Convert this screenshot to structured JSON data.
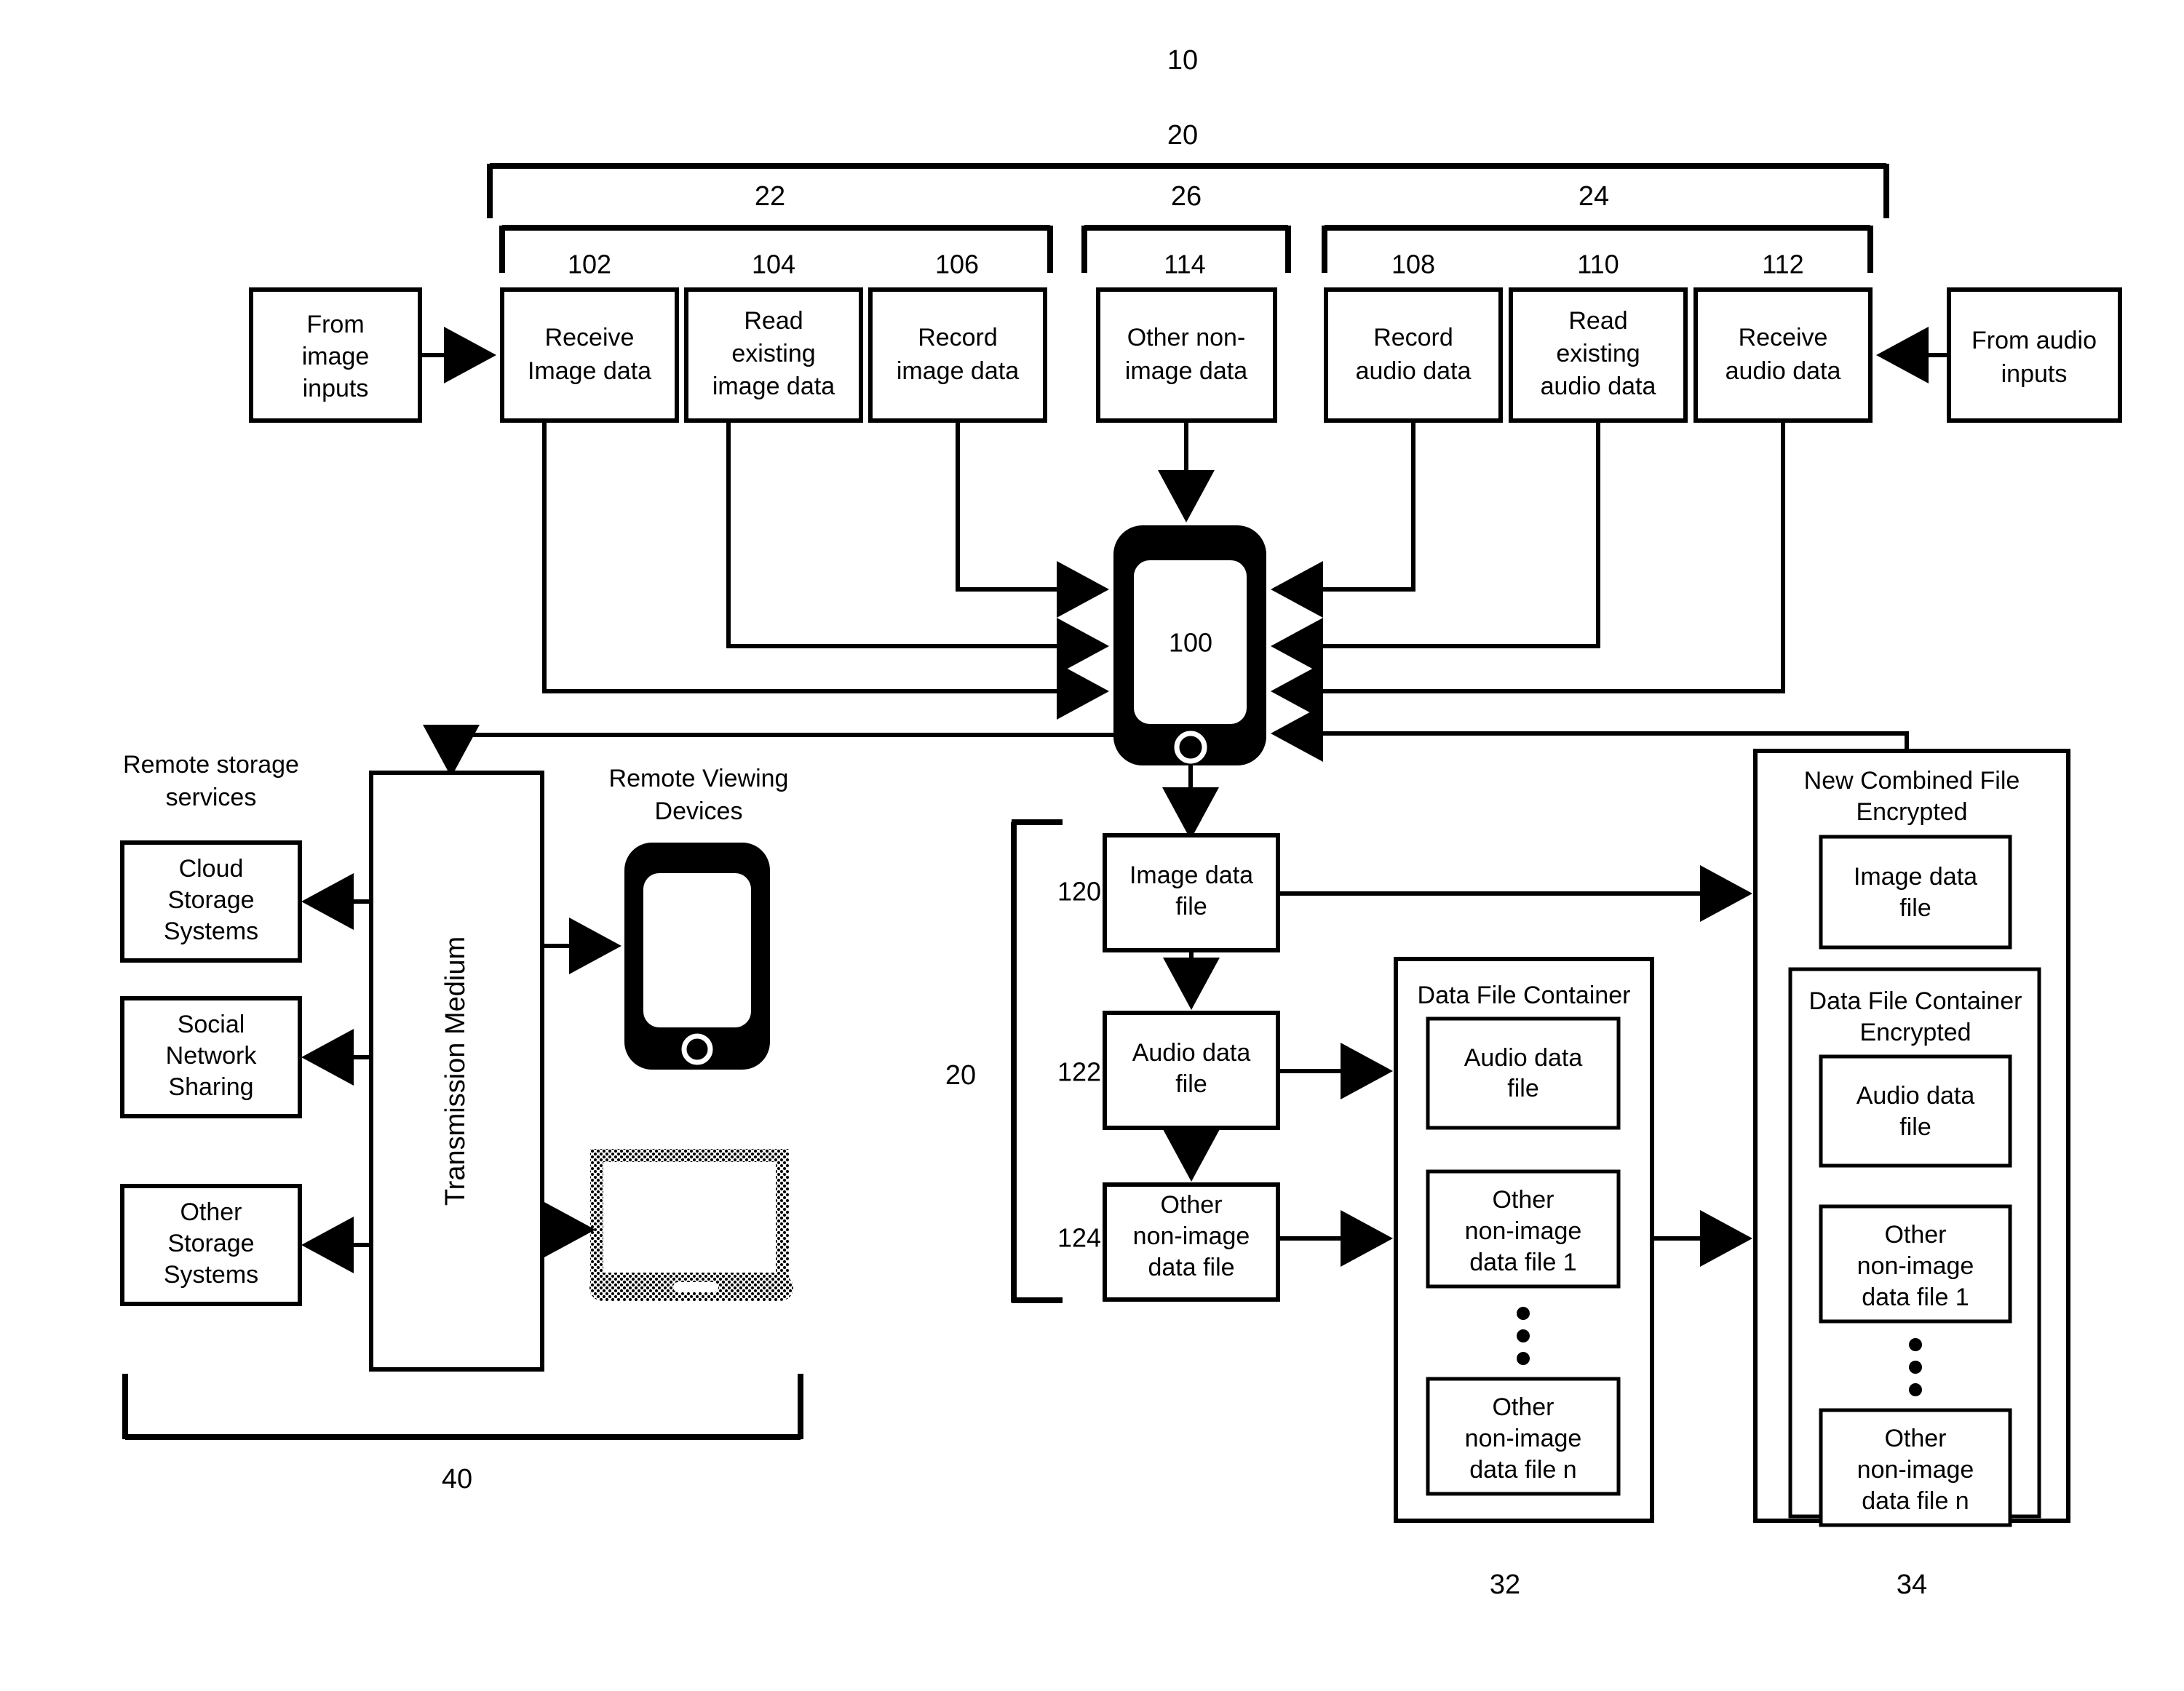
{
  "figure": {
    "top_label": "10",
    "system_label": "20",
    "group_image": "22",
    "group_other": "26",
    "group_audio": "24",
    "files_group_label": "20",
    "transmission_group_label": "40",
    "container_label": "32",
    "encrypted_label": "34"
  },
  "inputs": {
    "image_source": "From\nimage\ninputs",
    "image_source_l1": "From",
    "image_source_l2": "image",
    "image_source_l3": "inputs",
    "audio_source_l1": "From audio",
    "audio_source_l2": "inputs"
  },
  "process_boxes": [
    {
      "ref": "102",
      "l1": "Receive",
      "l2": "Image data",
      "l3": ""
    },
    {
      "ref": "104",
      "l1": "Read",
      "l2": "existing",
      "l3": "image data"
    },
    {
      "ref": "106",
      "l1": "Record",
      "l2": "image data",
      "l3": ""
    },
    {
      "ref": "114",
      "l1": "Other non-",
      "l2": "image data",
      "l3": ""
    },
    {
      "ref": "108",
      "l1": "Record",
      "l2": "audio data",
      "l3": ""
    },
    {
      "ref": "110",
      "l1": "Read",
      "l2": "existing",
      "l3": "audio data"
    },
    {
      "ref": "112",
      "l1": "Receive",
      "l2": "audio data",
      "l3": ""
    }
  ],
  "device": {
    "ref": "100"
  },
  "remote_storage": {
    "heading_l1": "Remote storage",
    "heading_l2": "services",
    "items": [
      {
        "l1": "Cloud",
        "l2": "Storage",
        "l3": "Systems"
      },
      {
        "l1": "Social",
        "l2": "Network",
        "l3": "Sharing"
      },
      {
        "l1": "Other",
        "l2": "Storage",
        "l3": "Systems"
      }
    ]
  },
  "transmission": {
    "label": "Transmission Medium"
  },
  "remote_viewing": {
    "heading_l1": "Remote Viewing",
    "heading_l2": "Devices"
  },
  "data_files": [
    {
      "ref": "120",
      "l1": "Image data",
      "l2": "file",
      "l3": ""
    },
    {
      "ref": "122",
      "l1": "Audio data",
      "l2": "file",
      "l3": ""
    },
    {
      "ref": "124",
      "l1": "Other",
      "l2": "non-image",
      "l3": "data file"
    }
  ],
  "data_file_container": {
    "title": "Data File Container",
    "items": [
      {
        "l1": "Audio data",
        "l2": "file",
        "l3": ""
      },
      {
        "l1": "Other",
        "l2": "non-image",
        "l3": "data file 1"
      },
      {
        "l1": "Other",
        "l2": "non-image",
        "l3": "data file n"
      }
    ],
    "ellipsis": "⋮"
  },
  "new_combined_file": {
    "title_l1": "New Combined File",
    "title_l2": "Encrypted",
    "image_file": {
      "l1": "Image data",
      "l2": "file"
    },
    "inner_title_l1": "Data File Container",
    "inner_title_l2": "Encrypted",
    "items": [
      {
        "l1": "Audio data",
        "l2": "file",
        "l3": ""
      },
      {
        "l1": "Other",
        "l2": "non-image",
        "l3": "data file 1"
      },
      {
        "l1": "Other",
        "l2": "non-image",
        "l3": "data file n"
      }
    ]
  },
  "colors": {
    "stroke": "#000000",
    "fill": "#ffffff",
    "device": "#000000"
  }
}
